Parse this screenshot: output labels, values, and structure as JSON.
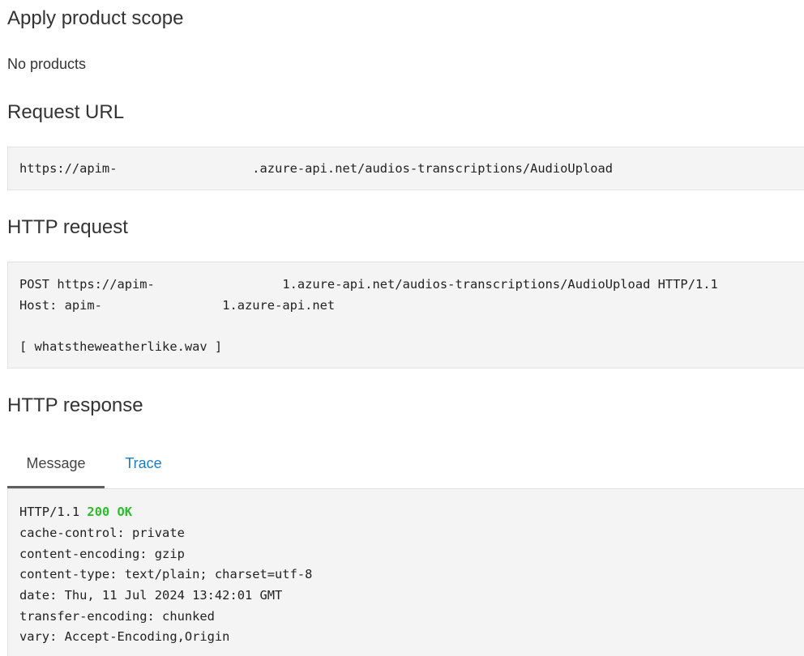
{
  "product_scope": {
    "heading": "Apply product scope",
    "value": "No products"
  },
  "request_url": {
    "heading": "Request URL",
    "prefix": "https://apim-",
    "suffix": ".azure-api.net/audios-transcriptions/AudioUpload"
  },
  "http_request": {
    "heading": "HTTP request",
    "line1_prefix": "POST https://apim-",
    "line1_suffix": "1.azure-api.net/audios-transcriptions/AudioUpload HTTP/1.1",
    "line2_prefix": "Host: apim-",
    "line2_suffix": "1.azure-api.net",
    "body": "[ whatstheweatherlike.wav ]"
  },
  "http_response": {
    "heading": "HTTP response",
    "tabs": [
      {
        "label": "Message",
        "active": true
      },
      {
        "label": "Trace",
        "active": false
      }
    ],
    "status_protocol": "HTTP/1.1",
    "status_code": "200 OK",
    "headers": [
      "cache-control: private",
      "content-encoding: gzip",
      "content-type: text/plain; charset=utf-8",
      "date: Thu, 11 Jul 2024 13:42:01 GMT",
      "transfer-encoding: chunked",
      "vary: Accept-Encoding,Origin"
    ]
  },
  "colors": {
    "status_ok": "#2bbb2b",
    "link": "#1a7dc5",
    "code_background": "#f4f4f4"
  }
}
